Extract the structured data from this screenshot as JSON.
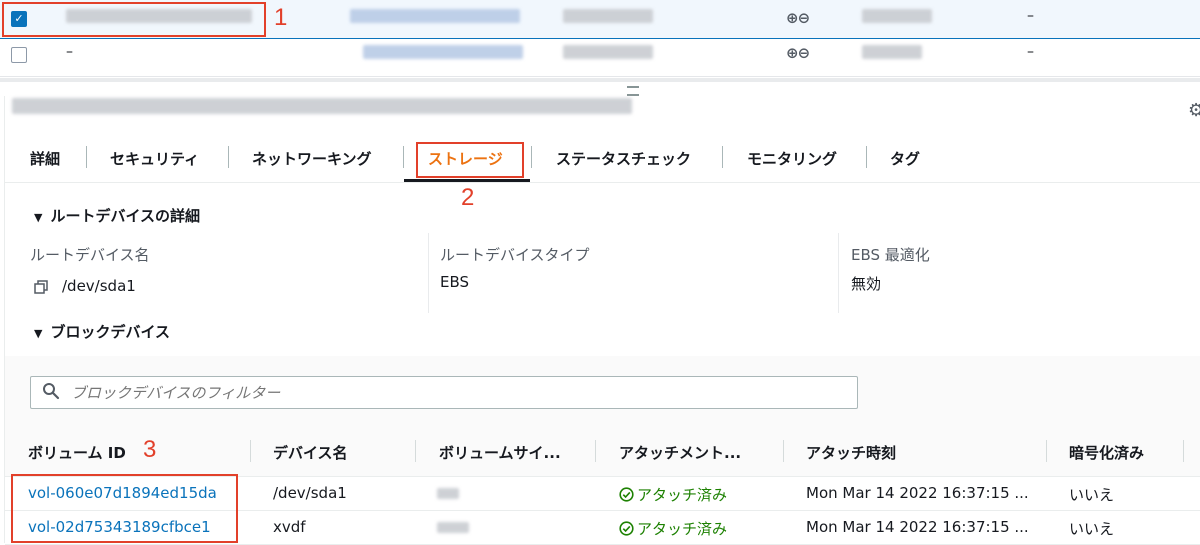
{
  "instance_list": {
    "rows": [
      {
        "checked": true,
        "last_col": "–"
      },
      {
        "checked": false,
        "name": "–",
        "last_col": "–"
      }
    ],
    "zoom_icons": "⊕⊖"
  },
  "annotations": {
    "n1": "1",
    "n2": "2",
    "n3": "3"
  },
  "tabs": [
    {
      "label": "詳細"
    },
    {
      "label": "セキュリティ"
    },
    {
      "label": "ネットワーキング"
    },
    {
      "label": "ストレージ"
    },
    {
      "label": "ステータスチェック"
    },
    {
      "label": "モニタリング"
    },
    {
      "label": "タグ"
    }
  ],
  "active_tab": "ストレージ",
  "root_device": {
    "section_title": "ルートデバイスの詳細",
    "name_label": "ルートデバイス名",
    "name_value": "/dev/sda1",
    "type_label": "ルートデバイスタイプ",
    "type_value": "EBS",
    "ebs_label": "EBS 最適化",
    "ebs_value": "無効"
  },
  "block_devices": {
    "section_title": "ブロックデバイス",
    "filter_placeholder": "ブロックデバイスのフィルター",
    "columns": [
      "ボリューム ID",
      "デバイス名",
      "ボリュームサイ...",
      "アタッチメント...",
      "アタッチ時刻",
      "暗号化済み"
    ],
    "rows": [
      {
        "volume_id": "vol-060e07d1894ed15da",
        "device": "/dev/sda1",
        "status": "アタッチ済み",
        "time": "Mon Mar 14 2022 16:37:15 ...",
        "encrypted": "いいえ"
      },
      {
        "volume_id": "vol-02d75343189cfbce1",
        "device": "xvdf",
        "status": "アタッチ済み",
        "time": "Mon Mar 14 2022 16:37:15 ...",
        "encrypted": "いいえ"
      }
    ]
  },
  "colors": {
    "accent": "#ec7211",
    "link": "#0a73bb",
    "success": "#1d8102",
    "annotation": "#e2402a"
  }
}
